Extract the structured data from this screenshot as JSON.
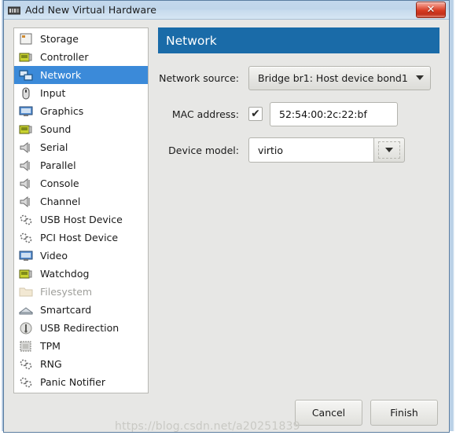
{
  "window": {
    "title": "Add New Virtual Hardware",
    "icon": "virtual-hardware-icon",
    "close_label": "✕",
    "titlebar_color": "#c3d8ec",
    "close_button_color": "#d63b22"
  },
  "hardware_list": {
    "selected": "Network",
    "selection_color": "#3b8ad9",
    "items": [
      {
        "label": "Storage",
        "icon": "storage-icon",
        "disabled": false
      },
      {
        "label": "Controller",
        "icon": "controller-icon",
        "disabled": false
      },
      {
        "label": "Network",
        "icon": "network-icon",
        "disabled": false
      },
      {
        "label": "Input",
        "icon": "input-mouse-icon",
        "disabled": false
      },
      {
        "label": "Graphics",
        "icon": "graphics-display-icon",
        "disabled": false
      },
      {
        "label": "Sound",
        "icon": "sound-card-icon",
        "disabled": false
      },
      {
        "label": "Serial",
        "icon": "serial-port-icon",
        "disabled": false
      },
      {
        "label": "Parallel",
        "icon": "parallel-port-icon",
        "disabled": false
      },
      {
        "label": "Console",
        "icon": "console-port-icon",
        "disabled": false
      },
      {
        "label": "Channel",
        "icon": "channel-port-icon",
        "disabled": false
      },
      {
        "label": "USB Host Device",
        "icon": "usb-host-gears-icon",
        "disabled": false
      },
      {
        "label": "PCI Host Device",
        "icon": "pci-host-gears-icon",
        "disabled": false
      },
      {
        "label": "Video",
        "icon": "video-display-icon",
        "disabled": false
      },
      {
        "label": "Watchdog",
        "icon": "watchdog-card-icon",
        "disabled": false
      },
      {
        "label": "Filesystem",
        "icon": "folder-icon",
        "disabled": true
      },
      {
        "label": "Smartcard",
        "icon": "smartcard-icon",
        "disabled": false
      },
      {
        "label": "USB Redirection",
        "icon": "usb-plug-icon",
        "disabled": false
      },
      {
        "label": "TPM",
        "icon": "tpm-chip-icon",
        "disabled": false
      },
      {
        "label": "RNG",
        "icon": "rng-gears-icon",
        "disabled": false
      },
      {
        "label": "Panic Notifier",
        "icon": "panic-gears-icon",
        "disabled": false
      }
    ]
  },
  "panel": {
    "header_title": "Network",
    "header_color": "#1a6ba8",
    "fields": {
      "network_source": {
        "label": "Network source:",
        "value": "Bridge br1: Host device bond1",
        "arrow_icon": "chevron-down-icon"
      },
      "mac_address": {
        "label": "MAC address:",
        "checked": true,
        "check_glyph": "✔",
        "value": "52:54:00:2c:22:bf"
      },
      "device_model": {
        "label": "Device model:",
        "value": "virtio",
        "arrow_icon": "chevron-down-icon"
      }
    }
  },
  "footer": {
    "cancel_label": "Cancel",
    "finish_label": "Finish"
  },
  "watermark": {
    "text": "https://blog.csdn.net/a20251839"
  }
}
